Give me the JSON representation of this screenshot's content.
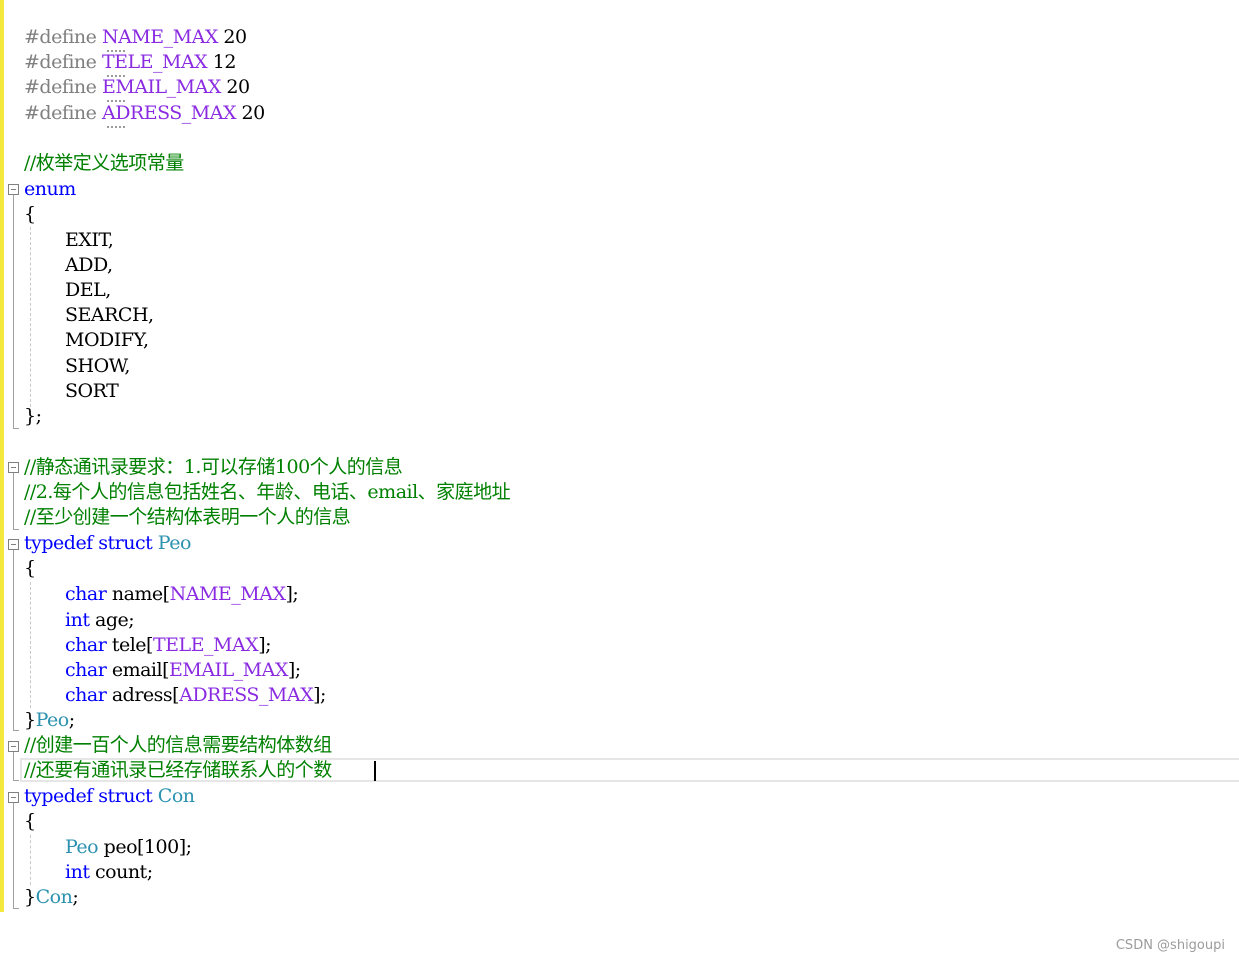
{
  "code": {
    "defines": [
      {
        "keyword": "#define",
        "name": "NAME_MAX",
        "value": "20"
      },
      {
        "keyword": "#define",
        "name": "TELE_MAX",
        "value": "12"
      },
      {
        "keyword": "#define",
        "name": "EMAIL_MAX",
        "value": "20"
      },
      {
        "keyword": "#define",
        "name": "ADRESS_MAX",
        "value": "20"
      }
    ],
    "enum_comment": "//枚举定义选项常量",
    "enum_keyword": "enum",
    "open_brace": "{",
    "enum_members": [
      "EXIT,",
      "ADD,",
      "DEL,",
      "SEARCH,",
      "MODIFY,",
      "SHOW,",
      "SORT"
    ],
    "enum_close": "};",
    "comments_1": [
      "//静态通讯录要求：1.可以存储100个人的信息",
      "//2.每个人的信息包括姓名、年龄、电话、email、家庭地址",
      "//至少创建一个结构体表明一个人的信息"
    ],
    "struct1": {
      "typedef": "typedef",
      "struct": "struct",
      "name": "Peo",
      "fields": [
        {
          "type": "char",
          "name": "name",
          "open": "[",
          "size": "NAME_MAX",
          "close": "];"
        },
        {
          "type": "int",
          "name": "age;",
          "open": "",
          "size": "",
          "close": ""
        },
        {
          "type": "char",
          "name": "tele",
          "open": "[",
          "size": "TELE_MAX",
          "close": "];"
        },
        {
          "type": "char",
          "name": "email",
          "open": "[",
          "size": "EMAIL_MAX",
          "close": "];"
        },
        {
          "type": "char",
          "name": "adress",
          "open": "[",
          "size": "ADRESS_MAX",
          "close": "];"
        }
      ],
      "close_brace": "}",
      "alias": "Peo",
      "semicolon": ";"
    },
    "comments_2": [
      "//创建一百个人的信息需要结构体数组",
      "//还要有通讯录已经存储联系人的个数"
    ],
    "struct2": {
      "typedef": "typedef",
      "struct": "struct",
      "name": "Con",
      "field1_type": "Peo",
      "field1_rest": "peo[100];",
      "field2_type": "int",
      "field2_rest": "count;",
      "close_brace": "}",
      "alias": "Con",
      "semicolon": ";"
    }
  },
  "watermark": "CSDN @shigoupi",
  "colors": {
    "preprocessor": "#808080",
    "macro": "#8a2be2",
    "keyword": "#0000ff",
    "type": "#2b91af",
    "comment": "#008000",
    "change_bar": "#f5e83c"
  }
}
